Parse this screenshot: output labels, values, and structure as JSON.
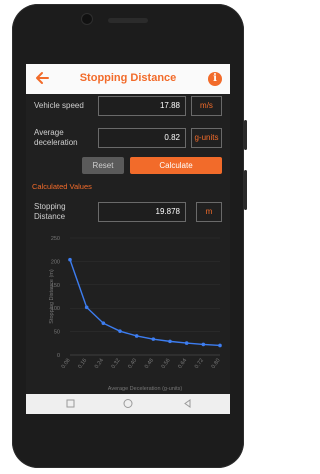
{
  "header": {
    "title": "Stopping Distance"
  },
  "inputs": {
    "speed": {
      "label": "Vehicle speed",
      "value": "17.88",
      "unit": "m/s"
    },
    "decel": {
      "label_line1": "Average",
      "label_line2": "deceleration",
      "value": "0.82",
      "unit": "g-units"
    }
  },
  "buttons": {
    "reset": "Reset",
    "calculate": "Calculate"
  },
  "results": {
    "section_title": "Calculated Values",
    "stopping": {
      "label_line1": "Stopping",
      "label_line2": "Distance",
      "value": "19.878",
      "unit": "m"
    }
  },
  "colors": {
    "accent": "#f26b2a",
    "line": "#3d7df0",
    "background": "#202020"
  },
  "icons": {
    "back": "arrow-left-icon",
    "info": "info-icon",
    "nav_back": "triangle-back-icon",
    "nav_home": "circle-home-icon",
    "nav_recent": "square-recent-icon"
  },
  "chart_data": {
    "type": "line",
    "xlabel": "Average Deceleration (g-units)",
    "ylabel": "Stopping Distance (m)",
    "x": [
      0.08,
      0.16,
      0.24,
      0.32,
      0.4,
      0.48,
      0.56,
      0.64,
      0.72,
      0.8
    ],
    "x_tick_labels": [
      "0.08",
      "0.16",
      "0.24",
      "0.32",
      "0.40",
      "0.48",
      "0.56",
      "0.64",
      "0.72",
      "0.80"
    ],
    "series": [
      {
        "values": [
          203.6,
          101.8,
          67.9,
          50.9,
          40.7,
          33.9,
          29.1,
          25.5,
          22.6,
          20.4
        ]
      }
    ],
    "y_ticks": [
      0,
      50,
      100,
      150,
      200,
      250
    ],
    "ylim": [
      0,
      250
    ],
    "xlim": [
      0.08,
      0.8
    ]
  }
}
